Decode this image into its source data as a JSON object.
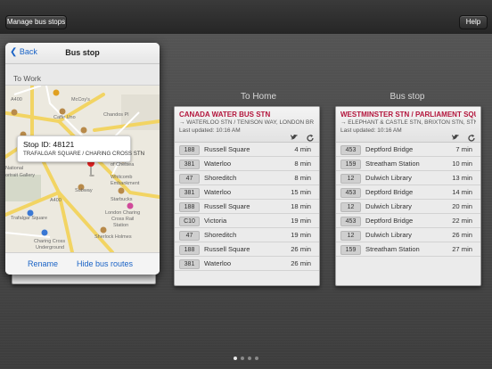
{
  "toolbar": {
    "manage_label": "Manage bus stops",
    "help_label": "Help"
  },
  "columns": [
    {
      "title": "To Home",
      "station": "CANADA WATER BUS STN",
      "via": "→ WATERLOO STN / TENISON WAY, LONDON BR",
      "updated": "Last updated: 10:16 AM",
      "rows": [
        {
          "route": "188",
          "dest": "Russell Square",
          "mins": "4 min"
        },
        {
          "route": "381",
          "dest": "Waterloo",
          "mins": "8 min"
        },
        {
          "route": "47",
          "dest": "Shoreditch",
          "mins": "8 min"
        },
        {
          "route": "381",
          "dest": "Waterloo",
          "mins": "15 min"
        },
        {
          "route": "188",
          "dest": "Russell Square",
          "mins": "18 min"
        },
        {
          "route": "C10",
          "dest": "Victoria",
          "mins": "19 min"
        },
        {
          "route": "47",
          "dest": "Shoreditch",
          "mins": "19 min"
        },
        {
          "route": "188",
          "dest": "Russell Square",
          "mins": "26 min"
        },
        {
          "route": "381",
          "dest": "Waterloo",
          "mins": "26 min"
        }
      ]
    },
    {
      "title": "Bus stop",
      "station": "WESTMINSTER STN / PARLIAMENT SQUA",
      "via": "→ ELEPHANT & CASTLE STN, BRIXTON STN, STN",
      "updated": "Last updated: 10:16 AM",
      "rows": [
        {
          "route": "453",
          "dest": "Deptford Bridge",
          "mins": "7 min"
        },
        {
          "route": "159",
          "dest": "Streatham Station",
          "mins": "10 min"
        },
        {
          "route": "12",
          "dest": "Dulwich Library",
          "mins": "13 min"
        },
        {
          "route": "453",
          "dest": "Deptford Bridge",
          "mins": "14 min"
        },
        {
          "route": "12",
          "dest": "Dulwich Library",
          "mins": "20 min"
        },
        {
          "route": "453",
          "dest": "Deptford Bridge",
          "mins": "22 min"
        },
        {
          "route": "12",
          "dest": "Dulwich Library",
          "mins": "26 min"
        },
        {
          "route": "159",
          "dest": "Streatham Station",
          "mins": "27 min"
        }
      ]
    }
  ],
  "popover": {
    "back_label": "Back",
    "title": "Bus stop",
    "group": "To Work",
    "callout_id": "Stop ID: 48121",
    "callout_name": "TRAFALGAR SQUARE / CHARING CROSS STN",
    "rename_label": "Rename",
    "hide_label": "Hide bus routes"
  },
  "map_labels": {
    "a400_top": "A400",
    "a400_bottom": "A400",
    "mccoy": "McCoy's",
    "caffe_uno": "Caffe Uno",
    "chandos": "Chandos Pl",
    "national": "National",
    "portrait": "ortrait Gallery",
    "whitcomb": "Whitcomb",
    "embankment": "Embankment",
    "subway": "Subway",
    "trafalgar": "Trafalgar Square",
    "charing_cross": "Charing Cross",
    "underground": "Underground",
    "starbucks": "Starbucks",
    "london_charing": "London Charing",
    "cross_rail": "Cross Rail",
    "station": "Station",
    "sherlock": "Sherlock Holmes",
    "whitehall": "Whitehall",
    "of_chelsea": "of Chelsea"
  },
  "colors": {
    "station_red": "#b3153c",
    "link_blue": "#1a63c6",
    "map_road": "#f2d463"
  },
  "pager": {
    "count": 4,
    "active": 0
  }
}
